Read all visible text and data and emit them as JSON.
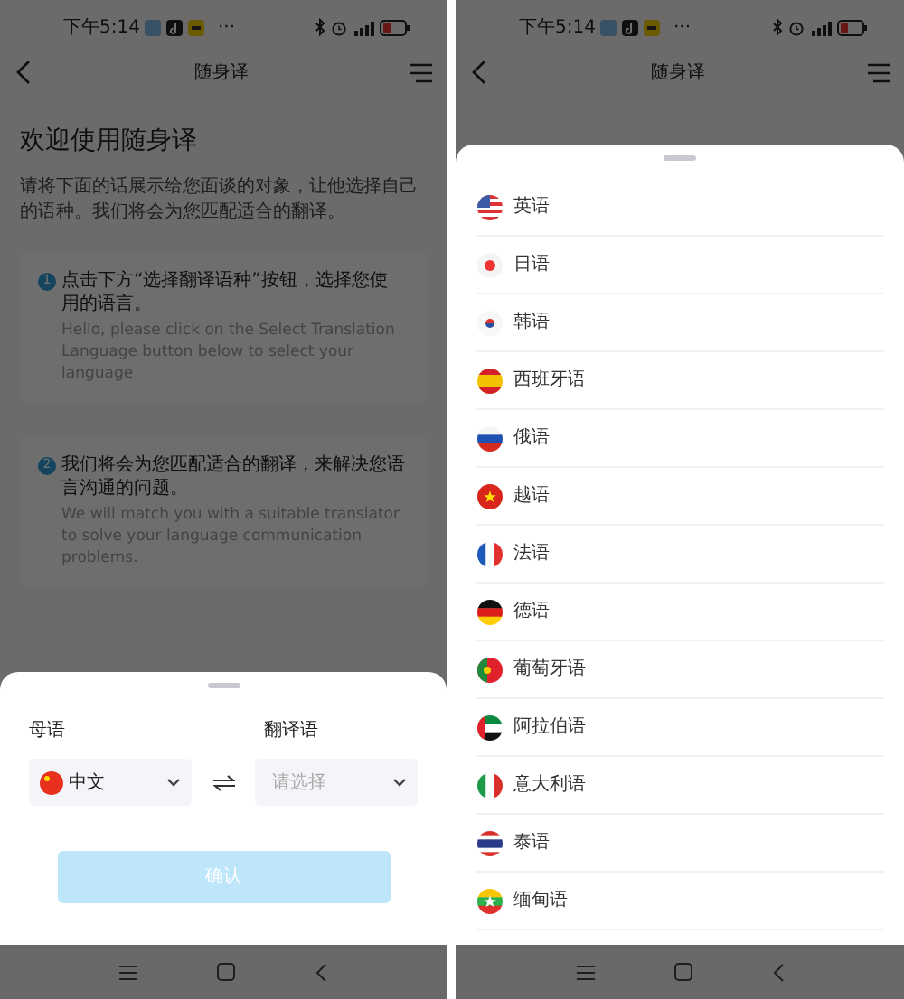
{
  "panels": [
    {
      "status_bar": {
        "time": "下午5:14",
        "more": "···"
      },
      "header": {
        "title": "随身译"
      },
      "intro": {
        "title": "欢迎使用随身译",
        "text": "请将下面的话展示给您面谈的对象，让他选择自己的语种。我们将会为您匹配适合的翻译。"
      },
      "steps": [
        {
          "number": "1",
          "text_zh": "点击下方“选择翻译语种”按钮，选择您使用的语言。",
          "text_en": "Hello, please click on the Select Translation Language button below to select your language"
        },
        {
          "number": "2",
          "text_zh": "我们将会为您匹配适合的翻译，来解决您语言沟通的问题。",
          "text_en": "We will match you with a suitable translator to solve your language communication problems."
        }
      ],
      "sheet": {
        "kind": "picker",
        "native": {
          "label": "母语",
          "value": "中文"
        },
        "target": {
          "label": "翻译语",
          "placeholder": "请选择"
        },
        "confirm": {
          "label": "确认",
          "disabled": true
        }
      }
    },
    {
      "status_bar": {
        "time": "下午5:14",
        "more": "···"
      },
      "header": {
        "title": "随身译"
      },
      "sheet": {
        "kind": "list",
        "languages": [
          {
            "name": "英语"
          },
          {
            "name": "日语"
          },
          {
            "name": "韩语"
          },
          {
            "name": "西班牙语"
          },
          {
            "name": "俄语"
          },
          {
            "name": "越语"
          },
          {
            "name": "法语"
          },
          {
            "name": "德语"
          },
          {
            "name": "葡萄牙语"
          },
          {
            "name": "阿拉伯语"
          },
          {
            "name": "意大利语"
          },
          {
            "name": "泰语"
          },
          {
            "name": "缅甸语"
          }
        ]
      }
    }
  ]
}
